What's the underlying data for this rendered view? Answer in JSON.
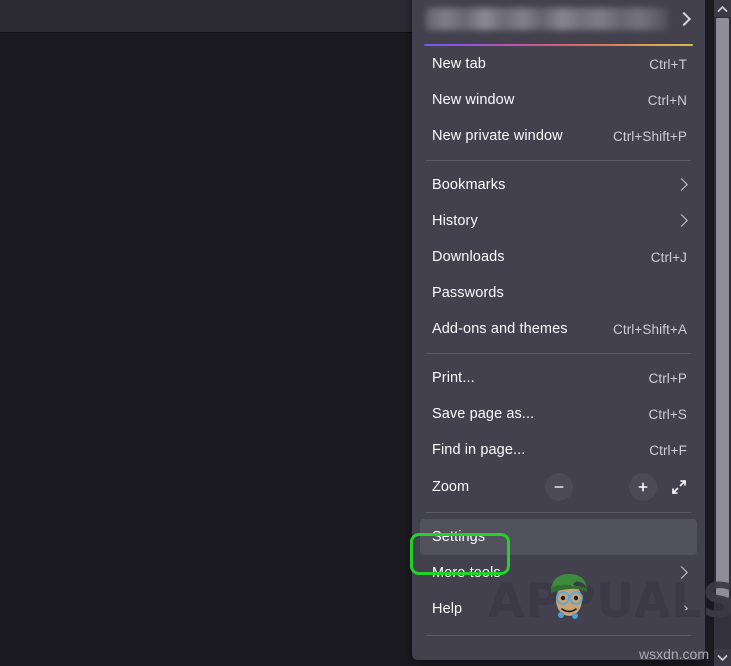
{
  "browser": {
    "chrome_label": "firefox-toolbar",
    "colors": {
      "toolbar": "#2b2a33",
      "content": "#1b1a21",
      "panel": "#42414d",
      "panel_text": "#fbfbfe",
      "accel_text": "#cfcdd6",
      "separator": "#5b5a66",
      "highlight": "#52525e",
      "annotation_green": "#22d12a",
      "scrollbar_thumb": "#8e8d98"
    }
  },
  "panel": {
    "account": {
      "name": "",
      "chevron_icon": "chevron-right-icon",
      "gradient_line": "firefox-account-gradient"
    },
    "groups": [
      {
        "items": [
          {
            "label": "New tab",
            "accel": "Ctrl+T",
            "submenu": false
          },
          {
            "label": "New window",
            "accel": "Ctrl+N",
            "submenu": false
          },
          {
            "label": "New private window",
            "accel": "Ctrl+Shift+P",
            "submenu": false
          }
        ]
      },
      {
        "items": [
          {
            "label": "Bookmarks",
            "accel": "",
            "submenu": true
          },
          {
            "label": "History",
            "accel": "",
            "submenu": true
          },
          {
            "label": "Downloads",
            "accel": "Ctrl+J",
            "submenu": false
          },
          {
            "label": "Passwords",
            "accel": "",
            "submenu": false
          },
          {
            "label": "Add-ons and themes",
            "accel": "Ctrl+Shift+A",
            "submenu": false
          }
        ]
      },
      {
        "items": [
          {
            "label": "Print...",
            "accel": "Ctrl+P",
            "submenu": false
          },
          {
            "label": "Save page as...",
            "accel": "Ctrl+S",
            "submenu": false
          },
          {
            "label": "Find in page...",
            "accel": "Ctrl+F",
            "submenu": false
          }
        ]
      }
    ],
    "zoom": {
      "label": "Zoom",
      "minus_icon": "minus-icon",
      "plus_icon": "plus-icon",
      "fullscreen_icon": "fullscreen-expand-icon"
    },
    "bottom_items": [
      {
        "label": "Settings",
        "accel": "",
        "submenu": false,
        "highlighted": true
      },
      {
        "label": "More tools",
        "accel": "",
        "submenu": true,
        "highlighted": false
      },
      {
        "label": "Help",
        "accel": "",
        "submenu": true,
        "highlighted": false
      }
    ]
  },
  "scrollbar": {
    "up_arrow_icon": "chevron-up-icon",
    "down_arrow_icon": "chevron-down-icon"
  },
  "annotations": {
    "settings_highlight_box": "green-rounded-rectangle"
  },
  "watermarks": {
    "brand": "APPUALS",
    "site": "wsxdn.com"
  }
}
